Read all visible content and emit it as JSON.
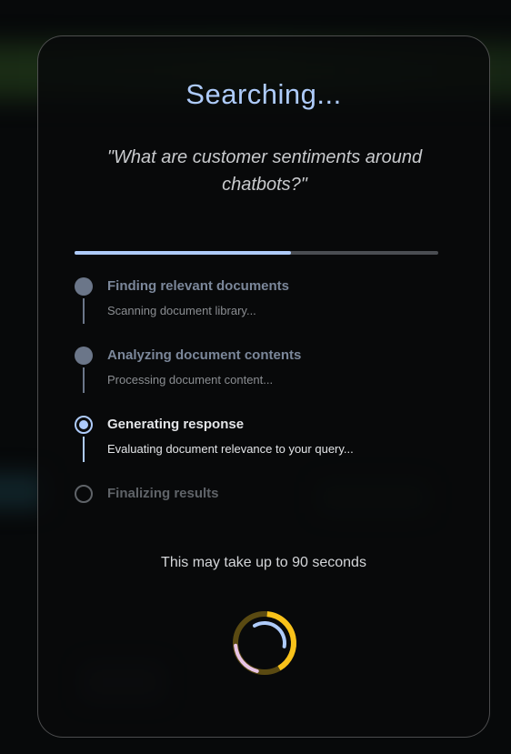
{
  "dialog": {
    "title": "Searching...",
    "query": "\"What are customer sentiments around chatbots?\"",
    "progress": 0.595,
    "steps": [
      {
        "label": "Finding relevant documents",
        "description": "Scanning document library...",
        "status": "done"
      },
      {
        "label": "Analyzing document contents",
        "description": "Processing document content...",
        "status": "done"
      },
      {
        "label": "Generating response",
        "description": "Evaluating document relevance to your query...",
        "status": "active"
      },
      {
        "label": "Finalizing results",
        "description": "",
        "status": "pending"
      }
    ],
    "hint": "This may take up to 90 seconds"
  },
  "colors": {
    "accent": "#aecbfa",
    "done": "#6b7689",
    "pending": "#5f6368",
    "spinner_yellow": "#f9c21a",
    "spinner_blue": "#aecbfa",
    "spinner_pink": "#e8c4e6"
  },
  "icons": {
    "spinner": "loading-spinner-icon"
  }
}
